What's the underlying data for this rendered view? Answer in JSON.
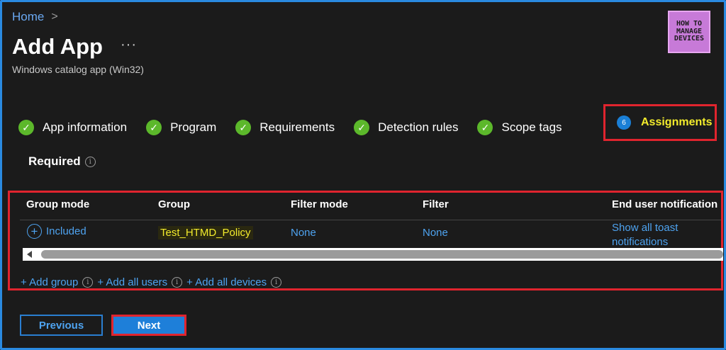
{
  "breadcrumb": {
    "home": "Home",
    "separator": ">"
  },
  "header": {
    "title": "Add App",
    "more": "···",
    "subtitle": "Windows catalog app (Win32)"
  },
  "logo": {
    "line1": "HOW TO",
    "line2": "MANAGE",
    "line3": "DEVICES"
  },
  "steps": [
    {
      "label": "App information",
      "status": "complete"
    },
    {
      "label": "Program",
      "status": "complete"
    },
    {
      "label": "Requirements",
      "status": "complete"
    },
    {
      "label": "Detection rules",
      "status": "complete"
    },
    {
      "label": "Scope tags",
      "status": "complete"
    }
  ],
  "active_step": {
    "number": "6",
    "label": "Assignments"
  },
  "section": {
    "label": "Required",
    "info": "i"
  },
  "table": {
    "headers": [
      "Group mode",
      "Group",
      "Filter mode",
      "Filter",
      "End user notification"
    ],
    "row": {
      "mode": "Included",
      "group": "Test_HTMD_Policy",
      "filter_mode": "None",
      "filter": "None",
      "notification_line1": "Show all toast",
      "notification_line2": "notifications"
    }
  },
  "add_links": {
    "group": "+ Add group",
    "users": "+ Add all users",
    "devices": "+ Add all devices"
  },
  "buttons": {
    "previous": "Previous",
    "next": "Next"
  },
  "colors": {
    "accent_blue": "#4ea3f0",
    "check_green": "#5cb82b",
    "highlight_red": "#e0242e",
    "active_yellow": "#f3ec2c",
    "background": "#1b1b1b"
  }
}
